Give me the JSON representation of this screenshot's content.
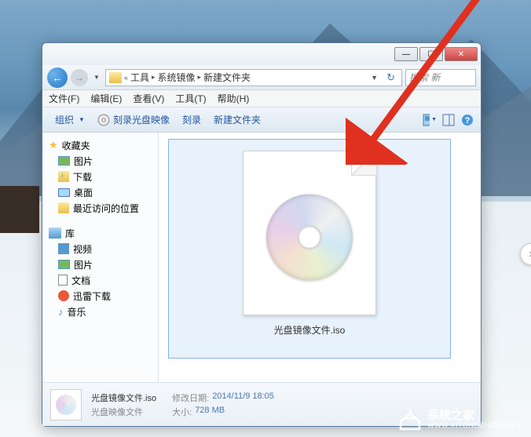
{
  "window": {
    "min": "—",
    "max": "☐",
    "close": "✕"
  },
  "breadcrumbs": {
    "sep_first": "«",
    "items": [
      "工具",
      "系统镜像",
      "新建文件夹"
    ],
    "sep": "▸"
  },
  "search": {
    "placeholder": "搜索 新"
  },
  "menubar": {
    "file": "文件(F)",
    "edit": "编辑(E)",
    "view": "查看(V)",
    "tools": "工具(T)",
    "help": "帮助(H)"
  },
  "toolbar": {
    "organize": "组织",
    "burn_image": "刻录光盘映像",
    "burn": "刻录",
    "new_folder": "新建文件夹"
  },
  "sidebar": {
    "favorites": "收藏夹",
    "pictures": "图片",
    "downloads": "下载",
    "desktop": "桌面",
    "recent": "最近访问的位置",
    "libraries": "库",
    "videos": "视频",
    "pictures2": "图片",
    "documents": "文档",
    "xunlei": "迅雷下载",
    "music": "音乐"
  },
  "file": {
    "name": "光盘镜像文件.iso"
  },
  "details": {
    "filename": "光盘镜像文件.iso",
    "filetype": "光盘映像文件",
    "modified_label": "修改日期:",
    "modified_value": "2014/11/9 18:05",
    "size_label": "大小:",
    "size_value": "728 MB"
  },
  "watermark": {
    "main": "系统之家",
    "sub": "WWW.XITONGZHIJIA.NET"
  }
}
